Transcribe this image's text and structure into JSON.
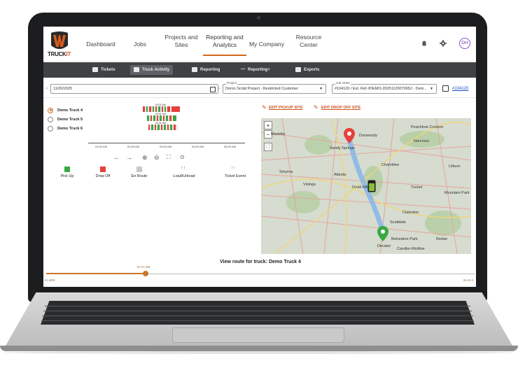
{
  "brand": {
    "logo_text_main": "TRUCK",
    "logo_text_accent": "IT"
  },
  "topnav": {
    "items": [
      {
        "label": "Dashboard"
      },
      {
        "label": "Jobs"
      },
      {
        "label": "Projects and Sites"
      },
      {
        "label": "Reporting and Analytics",
        "active": true
      },
      {
        "label": "My Company"
      },
      {
        "label": "Resource Center"
      }
    ],
    "icons": [
      "bell-icon",
      "gear-icon"
    ],
    "avatar_initials": "DH"
  },
  "subnav": {
    "tabs": [
      {
        "label": "Tickets",
        "icon": "tickets-icon"
      },
      {
        "label": "Truck Activity",
        "icon": "truck-icon",
        "active": true
      },
      {
        "label": "Reporting",
        "icon": "report-icon"
      },
      {
        "label": "Reporting+",
        "icon": "trend-icon"
      },
      {
        "label": "Exports",
        "icon": "export-icon"
      }
    ]
  },
  "filters": {
    "date": "11/20/2025",
    "project_label": "Project",
    "project_value": "Demo Script Project - Restricted Customer",
    "job_order_label": "Job Order",
    "job_order_value": "#104120 / Ext. Ref #DEMO-20251120070652 - Dem...",
    "job_link": "#104120"
  },
  "trucks": [
    {
      "name": "Demo Truck 4",
      "selected": true
    },
    {
      "name": "Demo Truck 5",
      "selected": false
    },
    {
      "name": "Demo Truck 6",
      "selected": false
    }
  ],
  "timeline": {
    "ticks": [
      "01:00 AM",
      "02:00 AM",
      "03:00 AM",
      "04:00 AM",
      "05:00 AM"
    ],
    "labels": [
      "03:31 AM",
      "03:31 AM",
      "03:31 AM"
    ]
  },
  "controls": [
    "arrow-left-icon",
    "arrow-right-icon",
    "zoom-in-icon",
    "zoom-out-icon",
    "fit-icon",
    "center-icon"
  ],
  "legend": [
    {
      "label": "Pick Up",
      "color": "#3aa845"
    },
    {
      "label": "Drop Off",
      "color": "#e6413c"
    },
    {
      "label": "En Route",
      "color": "#c8c8c8"
    },
    {
      "label": "Load/Unload"
    },
    {
      "label": "Ticket Event"
    }
  ],
  "map": {
    "edit_pickup": "EDIT PICKUP SITE",
    "edit_dropoff": "EDIT DROP OFF SITE",
    "places": [
      "Atlanta",
      "Sandy Springs",
      "Dunwoody",
      "Peachtree Corners",
      "Norcross",
      "Chamblee",
      "Tucker",
      "Lilburn",
      "Mountain Park",
      "Smyrna",
      "Vinings",
      "Druid Hills",
      "Decatur",
      "Scottdale",
      "Clarkston",
      "Belvedere Park",
      "Candler-McAfee",
      "Redan",
      "Marietta"
    ]
  },
  "route_title": "View route for truck: Demo Truck 4",
  "slider": {
    "value_label": "02:51 AM",
    "min_label": "01:45M",
    "max_label": "04:03 A",
    "fraction": 0.23
  }
}
